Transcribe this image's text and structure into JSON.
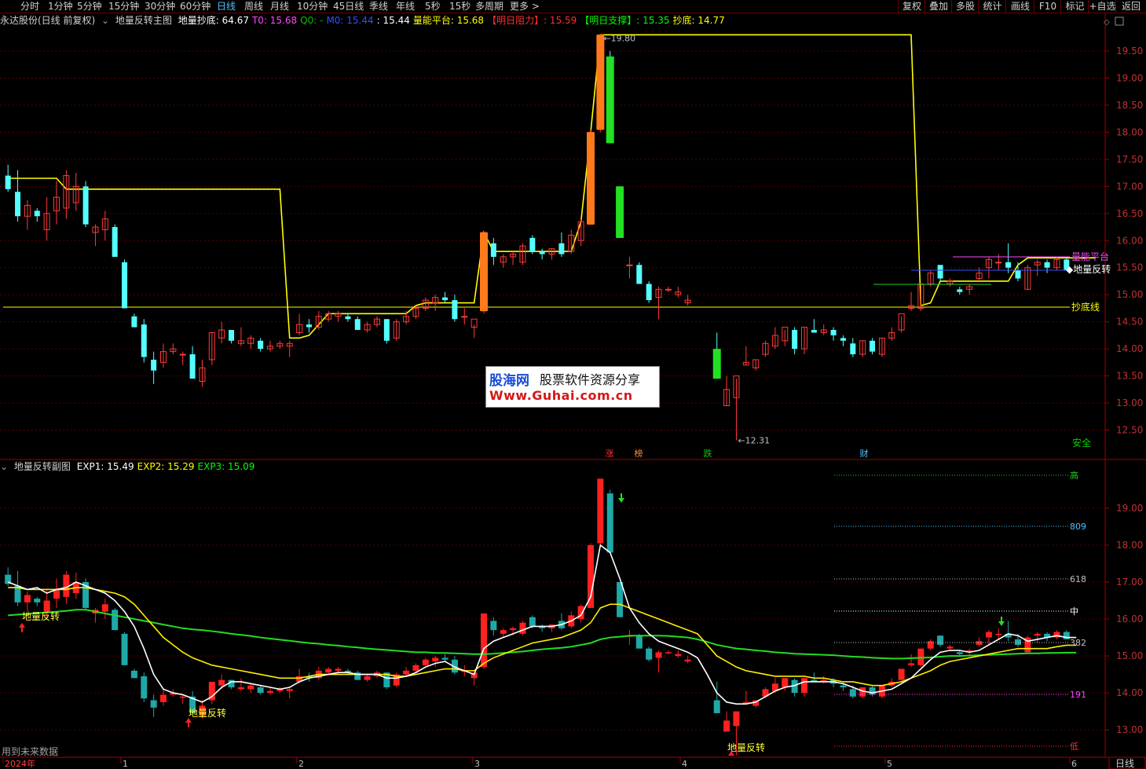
{
  "toolbar": {
    "periods": [
      "分时",
      "1分钟",
      "5分钟",
      "15分钟",
      "30分钟",
      "60分钟",
      "日线",
      "周线",
      "月线",
      "10分钟",
      "45日线",
      "季线",
      "年线",
      "5秒",
      "15秒",
      "多周期",
      "更多 >"
    ],
    "active": "日线",
    "right_buttons": [
      "复权",
      "叠加",
      "多股",
      "统计",
      "画线",
      "F10",
      "标记",
      "+自选",
      "返回"
    ]
  },
  "main_info": {
    "stock": "永达股份(日线 前复权)",
    "indicator": "地量反转主图",
    "items": [
      {
        "label": "地量抄底:",
        "value": "64.67",
        "color": "#ffffff"
      },
      {
        "label": "T0:",
        "value": "15.68",
        "color": "#ff44ff"
      },
      {
        "label": "Q0:",
        "value": "-",
        "color": "#00c000"
      },
      {
        "label": "M0:",
        "value": "15.44",
        "color": "#3050ff"
      },
      {
        "label": ":",
        "value": "15.44",
        "color": "#ffffff"
      },
      {
        "label": "量能平台:",
        "value": "15.68",
        "color": "#ffff00"
      },
      {
        "label": "【明日阻力】:",
        "value": "15.59",
        "color": "#ff3030"
      },
      {
        "label": "【明日支撑】:",
        "value": "15.35",
        "color": "#00ff00"
      },
      {
        "label": "抄底:",
        "value": "14.77",
        "color": "#ffff00"
      }
    ]
  },
  "sub_info": {
    "indicator": "地量反转副图",
    "items": [
      {
        "label": "EXP1:",
        "value": "15.49",
        "color": "#ffffff"
      },
      {
        "label": "EXP2:",
        "value": "15.29",
        "color": "#ffff00"
      },
      {
        "label": "EXP3:",
        "value": "15.09",
        "color": "#00ff00"
      }
    ]
  },
  "main_axis_ticks": [
    19.5,
    19.0,
    18.5,
    18.0,
    17.5,
    17.0,
    16.5,
    16.0,
    15.5,
    15.0,
    14.5,
    14.0,
    13.5,
    13.0,
    12.5
  ],
  "sub_axis_ticks": [
    19.0,
    18.0,
    17.0,
    16.0,
    15.0,
    14.0,
    13.0
  ],
  "annotations": {
    "high_label": "19.80",
    "low_label": "12.31",
    "volume_platform": "量能平台",
    "reversal_right": "◆地量反转",
    "bottom_line": "抄底线",
    "safe": "安全",
    "signals": [
      "涨",
      "榜",
      "跌",
      "财"
    ],
    "sub_reversal": "地量反转",
    "fib": [
      "高",
      "809",
      "618",
      "中",
      "382",
      "191",
      "低"
    ],
    "future_data_note": "用到未来数据"
  },
  "time_axis": [
    "2024年",
    "1",
    "2",
    "3",
    "4",
    "5",
    "6"
  ],
  "period_badge": "日线",
  "watermark": {
    "line1a": "股海网",
    "line1b": "股票软件资源分享",
    "line2": "Www.Guhai.com.cn"
  },
  "chart_data": {
    "type": "candlestick",
    "price_range": [
      12.0,
      19.95
    ],
    "candles": [
      {
        "o": 17.2,
        "h": 17.4,
        "l": 16.9,
        "c": 16.95
      },
      {
        "o": 16.9,
        "h": 17.3,
        "l": 16.35,
        "c": 16.45
      },
      {
        "o": 16.45,
        "h": 16.75,
        "l": 16.2,
        "c": 16.65
      },
      {
        "o": 16.55,
        "h": 16.6,
        "l": 16.35,
        "c": 16.45
      },
      {
        "o": 16.2,
        "h": 16.8,
        "l": 16.0,
        "c": 16.5
      },
      {
        "o": 16.55,
        "h": 17.1,
        "l": 16.3,
        "c": 16.8
      },
      {
        "o": 16.6,
        "h": 17.3,
        "l": 16.4,
        "c": 17.2
      },
      {
        "o": 16.7,
        "h": 17.25,
        "l": 16.55,
        "c": 17.0
      },
      {
        "o": 17.0,
        "h": 17.1,
        "l": 16.25,
        "c": 16.3
      },
      {
        "o": 16.15,
        "h": 16.3,
        "l": 15.9,
        "c": 16.25
      },
      {
        "o": 16.2,
        "h": 16.55,
        "l": 16.0,
        "c": 16.4
      },
      {
        "o": 16.25,
        "h": 16.3,
        "l": 15.7,
        "c": 15.7
      },
      {
        "o": 15.6,
        "h": 15.65,
        "l": 14.75,
        "c": 14.75
      },
      {
        "o": 14.6,
        "h": 14.65,
        "l": 14.4,
        "c": 14.4
      },
      {
        "o": 14.45,
        "h": 14.55,
        "l": 13.75,
        "c": 13.85
      },
      {
        "o": 13.8,
        "h": 13.95,
        "l": 13.35,
        "c": 13.6
      },
      {
        "o": 13.75,
        "h": 14.1,
        "l": 13.65,
        "c": 13.95
      },
      {
        "o": 13.95,
        "h": 14.1,
        "l": 13.9,
        "c": 14.0
      },
      {
        "o": 13.9,
        "h": 13.95,
        "l": 13.7,
        "c": 13.9
      },
      {
        "o": 13.9,
        "h": 14.05,
        "l": 13.6,
        "c": 13.45
      },
      {
        "o": 13.4,
        "h": 13.8,
        "l": 13.3,
        "c": 13.65
      },
      {
        "o": 13.8,
        "h": 14.3,
        "l": 13.7,
        "c": 14.3
      },
      {
        "o": 14.2,
        "h": 14.5,
        "l": 14.1,
        "c": 14.35
      },
      {
        "o": 14.35,
        "h": 14.35,
        "l": 14.1,
        "c": 14.15
      },
      {
        "o": 14.1,
        "h": 14.4,
        "l": 14.05,
        "c": 14.15
      },
      {
        "o": 14.1,
        "h": 14.25,
        "l": 14.0,
        "c": 14.2
      },
      {
        "o": 14.15,
        "h": 14.2,
        "l": 13.95,
        "c": 14.0
      },
      {
        "o": 14.0,
        "h": 14.15,
        "l": 13.95,
        "c": 14.05
      },
      {
        "o": 14.05,
        "h": 14.15,
        "l": 14.0,
        "c": 14.1
      },
      {
        "o": 14.05,
        "h": 14.15,
        "l": 13.85,
        "c": 14.1
      },
      {
        "o": 14.3,
        "h": 14.65,
        "l": 14.25,
        "c": 14.45
      },
      {
        "o": 14.45,
        "h": 14.55,
        "l": 14.3,
        "c": 14.4
      },
      {
        "o": 14.4,
        "h": 14.7,
        "l": 14.35,
        "c": 14.6
      },
      {
        "o": 14.55,
        "h": 14.7,
        "l": 14.5,
        "c": 14.65
      },
      {
        "o": 14.6,
        "h": 14.7,
        "l": 14.5,
        "c": 14.65
      },
      {
        "o": 14.6,
        "h": 14.65,
        "l": 14.5,
        "c": 14.55
      },
      {
        "o": 14.55,
        "h": 14.6,
        "l": 14.35,
        "c": 14.35
      },
      {
        "o": 14.35,
        "h": 14.5,
        "l": 14.3,
        "c": 14.45
      },
      {
        "o": 14.45,
        "h": 14.6,
        "l": 14.4,
        "c": 14.55
      },
      {
        "o": 14.55,
        "h": 14.55,
        "l": 14.1,
        "c": 14.15
      },
      {
        "o": 14.2,
        "h": 14.55,
        "l": 14.15,
        "c": 14.5
      },
      {
        "o": 14.5,
        "h": 14.7,
        "l": 14.45,
        "c": 14.6
      },
      {
        "o": 14.6,
        "h": 14.8,
        "l": 14.55,
        "c": 14.75
      },
      {
        "o": 14.75,
        "h": 14.95,
        "l": 14.7,
        "c": 14.9
      },
      {
        "o": 14.85,
        "h": 15.0,
        "l": 14.7,
        "c": 14.95
      },
      {
        "o": 14.95,
        "h": 15.05,
        "l": 14.85,
        "c": 14.9
      },
      {
        "o": 14.9,
        "h": 15.0,
        "l": 14.5,
        "c": 14.55
      },
      {
        "o": 14.6,
        "h": 14.75,
        "l": 14.45,
        "c": 14.6
      },
      {
        "o": 14.4,
        "h": 14.45,
        "l": 14.2,
        "c": 14.55
      },
      {
        "o": 14.7,
        "h": 16.15,
        "l": 14.65,
        "c": 16.15
      },
      {
        "o": 15.95,
        "h": 16.05,
        "l": 15.55,
        "c": 15.7
      },
      {
        "o": 15.6,
        "h": 15.75,
        "l": 15.5,
        "c": 15.7
      },
      {
        "o": 15.7,
        "h": 15.8,
        "l": 15.55,
        "c": 15.75
      },
      {
        "o": 15.6,
        "h": 15.95,
        "l": 15.55,
        "c": 15.9
      },
      {
        "o": 16.05,
        "h": 16.1,
        "l": 15.75,
        "c": 15.8
      },
      {
        "o": 15.8,
        "h": 15.85,
        "l": 15.65,
        "c": 15.75
      },
      {
        "o": 15.75,
        "h": 15.85,
        "l": 15.65,
        "c": 15.85
      },
      {
        "o": 15.95,
        "h": 16.15,
        "l": 15.7,
        "c": 15.75
      },
      {
        "o": 15.8,
        "h": 16.2,
        "l": 15.75,
        "c": 16.1
      },
      {
        "o": 16.0,
        "h": 16.4,
        "l": 15.9,
        "c": 16.35
      },
      {
        "o": 16.3,
        "h": 18.05,
        "l": 16.3,
        "c": 18.0
      },
      {
        "o": 18.05,
        "h": 19.8,
        "l": 18.0,
        "c": 19.8
      },
      {
        "o": 19.4,
        "h": 19.5,
        "l": 17.8,
        "c": 17.8
      },
      {
        "o": 17.0,
        "h": 17.0,
        "l": 16.05,
        "c": 16.05
      },
      {
        "o": 15.55,
        "h": 15.7,
        "l": 15.3,
        "c": 15.55
      },
      {
        "o": 15.55,
        "h": 15.6,
        "l": 15.2,
        "c": 15.2
      },
      {
        "o": 15.2,
        "h": 15.25,
        "l": 14.85,
        "c": 14.9
      },
      {
        "o": 14.95,
        "h": 15.15,
        "l": 14.55,
        "c": 15.1
      },
      {
        "o": 15.1,
        "h": 15.15,
        "l": 15.05,
        "c": 15.1
      },
      {
        "o": 15.0,
        "h": 15.15,
        "l": 14.95,
        "c": 15.05
      },
      {
        "o": 14.85,
        "h": 15.0,
        "l": 14.8,
        "c": 14.9
      },
      null,
      null,
      {
        "o": 13.8,
        "h": 14.3,
        "l": 13.45,
        "c": 13.45
      },
      {
        "o": 12.95,
        "h": 13.5,
        "l": 12.95,
        "c": 13.25
      },
      {
        "o": 13.1,
        "h": 13.45,
        "l": 12.31,
        "c": 13.5
      },
      {
        "o": 13.7,
        "h": 14.05,
        "l": 13.7,
        "c": 13.75
      },
      {
        "o": 13.65,
        "h": 13.8,
        "l": 13.6,
        "c": 13.8
      },
      {
        "o": 13.9,
        "h": 14.15,
        "l": 13.85,
        "c": 14.1
      },
      {
        "o": 14.05,
        "h": 14.4,
        "l": 14.0,
        "c": 14.25
      },
      {
        "o": 14.15,
        "h": 14.35,
        "l": 14.05,
        "c": 14.4
      },
      {
        "o": 14.35,
        "h": 14.4,
        "l": 13.9,
        "c": 14.0
      },
      {
        "o": 14.0,
        "h": 14.4,
        "l": 13.9,
        "c": 14.4
      },
      {
        "o": 14.35,
        "h": 14.55,
        "l": 14.3,
        "c": 14.3
      },
      {
        "o": 14.3,
        "h": 14.45,
        "l": 14.25,
        "c": 14.35
      },
      {
        "o": 14.35,
        "h": 14.4,
        "l": 14.15,
        "c": 14.25
      },
      {
        "o": 14.2,
        "h": 14.25,
        "l": 14.05,
        "c": 14.15
      },
      {
        "o": 14.1,
        "h": 14.2,
        "l": 13.85,
        "c": 13.9
      },
      {
        "o": 13.9,
        "h": 14.15,
        "l": 13.85,
        "c": 14.15
      },
      {
        "o": 14.15,
        "h": 14.2,
        "l": 13.9,
        "c": 13.95
      },
      {
        "o": 13.9,
        "h": 14.2,
        "l": 13.85,
        "c": 14.2
      },
      {
        "o": 14.2,
        "h": 14.4,
        "l": 14.15,
        "c": 14.3
      },
      {
        "o": 14.35,
        "h": 14.6,
        "l": 14.3,
        "c": 14.65
      },
      {
        "o": 14.75,
        "h": 15.05,
        "l": 14.7,
        "c": 14.8
      },
      {
        "o": 14.75,
        "h": 15.2,
        "l": 14.7,
        "c": 15.2
      },
      {
        "o": 15.2,
        "h": 15.45,
        "l": 15.15,
        "c": 15.4
      },
      {
        "o": 15.55,
        "h": 15.55,
        "l": 15.25,
        "c": 15.3
      },
      {
        "o": 15.2,
        "h": 15.3,
        "l": 15.15,
        "c": 15.25
      },
      {
        "o": 15.1,
        "h": 15.15,
        "l": 15.0,
        "c": 15.05
      },
      {
        "o": 15.1,
        "h": 15.2,
        "l": 15.0,
        "c": 15.15
      },
      {
        "o": 15.3,
        "h": 15.5,
        "l": 15.25,
        "c": 15.4
      },
      {
        "o": 15.5,
        "h": 15.7,
        "l": 15.3,
        "c": 15.65
      },
      {
        "o": 15.6,
        "h": 15.75,
        "l": 15.45,
        "c": 15.6
      },
      {
        "o": 15.6,
        "h": 15.95,
        "l": 15.4,
        "c": 15.5
      },
      {
        "o": 15.45,
        "h": 15.6,
        "l": 15.25,
        "c": 15.3
      },
      {
        "o": 15.1,
        "h": 15.55,
        "l": 15.1,
        "c": 15.5
      },
      {
        "o": 15.55,
        "h": 15.65,
        "l": 15.35,
        "c": 15.6
      },
      {
        "o": 15.6,
        "h": 15.65,
        "l": 15.4,
        "c": 15.5
      },
      {
        "o": 15.5,
        "h": 15.7,
        "l": 15.45,
        "c": 15.65
      },
      {
        "o": 15.65,
        "h": 15.7,
        "l": 15.45,
        "c": 15.45
      }
    ],
    "platform_line": [
      17.15,
      17.15,
      17.15,
      17.15,
      17.15,
      17.15,
      16.95,
      16.95,
      16.95,
      16.95,
      16.95,
      16.95,
      16.95,
      16.95,
      16.95,
      16.95,
      16.95,
      16.95,
      16.95,
      16.95,
      16.95,
      16.95,
      16.95,
      16.95,
      16.95,
      16.95,
      16.95,
      16.95,
      16.95,
      14.2,
      14.2,
      14.25,
      14.45,
      14.65,
      14.65,
      14.65,
      14.65,
      14.65,
      14.65,
      14.65,
      14.65,
      14.65,
      14.8,
      14.85,
      14.85,
      14.85,
      14.85,
      14.85,
      14.85,
      16.15,
      15.8,
      15.8,
      15.8,
      15.8,
      15.8,
      15.8,
      15.8,
      15.8,
      15.8,
      16.35,
      18.0,
      19.8,
      19.8,
      19.8,
      19.8,
      19.8,
      19.8,
      19.8,
      19.8,
      19.8,
      19.8,
      19.8,
      19.8,
      19.8,
      19.8,
      19.8,
      19.8,
      19.8,
      19.8,
      19.8,
      19.8,
      19.8,
      19.8,
      19.8,
      19.8,
      19.8,
      19.8,
      19.8,
      19.8,
      19.8,
      19.8,
      19.8,
      19.8,
      19.8,
      14.8,
      14.85,
      15.25,
      15.25,
      15.25,
      15.25,
      15.25,
      15.25,
      15.25,
      15.25,
      15.55,
      15.68,
      15.68,
      15.68,
      15.68,
      15.68,
      15.68,
      15.68,
      15.68
    ],
    "bottom_line": 14.77,
    "sub_chart": {
      "exp1_white": [
        17.0,
        16.9,
        16.8,
        16.85,
        16.7,
        16.8,
        16.85,
        17.0,
        16.9,
        16.8,
        16.7,
        16.5,
        16.2,
        15.8,
        15.2,
        14.5,
        14.1,
        14.0,
        13.95,
        13.85,
        13.75,
        13.9,
        14.15,
        14.3,
        14.3,
        14.25,
        14.2,
        14.15,
        14.1,
        14.15,
        14.3,
        14.4,
        14.45,
        14.5,
        14.55,
        14.55,
        14.5,
        14.5,
        14.5,
        14.4,
        14.4,
        14.45,
        14.55,
        14.7,
        14.8,
        14.85,
        14.7,
        14.6,
        14.5,
        15.2,
        15.4,
        15.5,
        15.6,
        15.7,
        15.8,
        15.8,
        15.8,
        15.85,
        15.95,
        16.1,
        16.6,
        18.0,
        17.8,
        17.1,
        16.3,
        15.9,
        15.6,
        15.4,
        15.3,
        15.2,
        15.1,
        14.95,
        14.5,
        14.0,
        13.75,
        13.7,
        13.7,
        13.75,
        13.9,
        14.05,
        14.15,
        14.2,
        14.3,
        14.3,
        14.3,
        14.3,
        14.25,
        14.15,
        14.05,
        14.0,
        14.05,
        14.1,
        14.25,
        14.4,
        14.65,
        14.9,
        15.1,
        15.15,
        15.15,
        15.1,
        15.15,
        15.3,
        15.45,
        15.6,
        15.55,
        15.4,
        15.45,
        15.5,
        15.55,
        15.5,
        15.5
      ],
      "exp2_yellow": [
        16.85,
        16.85,
        16.8,
        16.8,
        16.8,
        16.8,
        16.8,
        16.85,
        16.85,
        16.8,
        16.75,
        16.7,
        16.6,
        16.4,
        16.1,
        15.8,
        15.5,
        15.3,
        15.1,
        14.95,
        14.85,
        14.75,
        14.7,
        14.65,
        14.6,
        14.55,
        14.5,
        14.45,
        14.4,
        14.4,
        14.4,
        14.45,
        14.5,
        14.5,
        14.5,
        14.5,
        14.5,
        14.5,
        14.5,
        14.5,
        14.45,
        14.45,
        14.5,
        14.55,
        14.6,
        14.65,
        14.65,
        14.6,
        14.6,
        14.8,
        14.95,
        15.05,
        15.15,
        15.25,
        15.35,
        15.4,
        15.45,
        15.5,
        15.6,
        15.7,
        15.9,
        16.3,
        16.4,
        16.4,
        16.3,
        16.2,
        16.1,
        16.0,
        15.9,
        15.8,
        15.7,
        15.6,
        15.3,
        15.0,
        14.85,
        14.7,
        14.6,
        14.55,
        14.5,
        14.45,
        14.45,
        14.45,
        14.45,
        14.4,
        14.4,
        14.35,
        14.3,
        14.3,
        14.25,
        14.2,
        14.2,
        14.25,
        14.3,
        14.4,
        14.5,
        14.6,
        14.75,
        14.85,
        14.9,
        14.95,
        15.0,
        15.05,
        15.1,
        15.15,
        15.2,
        15.2,
        15.2,
        15.2,
        15.25,
        15.29,
        15.29
      ],
      "exp3_green": [
        16.1,
        16.12,
        16.14,
        16.16,
        16.18,
        16.2,
        16.22,
        16.25,
        16.25,
        16.2,
        16.15,
        16.1,
        16.05,
        16.0,
        15.95,
        15.9,
        15.85,
        15.8,
        15.75,
        15.72,
        15.7,
        15.67,
        15.64,
        15.6,
        15.57,
        15.54,
        15.5,
        15.47,
        15.44,
        15.41,
        15.38,
        15.35,
        15.33,
        15.3,
        15.28,
        15.25,
        15.23,
        15.2,
        15.18,
        15.16,
        15.14,
        15.12,
        15.1,
        15.1,
        15.08,
        15.08,
        15.07,
        15.06,
        15.05,
        15.05,
        15.06,
        15.08,
        15.1,
        15.12,
        15.15,
        15.18,
        15.2,
        15.22,
        15.25,
        15.3,
        15.35,
        15.45,
        15.5,
        15.52,
        15.55,
        15.55,
        15.55,
        15.55,
        15.54,
        15.52,
        15.5,
        15.45,
        15.38,
        15.3,
        15.25,
        15.2,
        15.18,
        15.15,
        15.13,
        15.1,
        15.08,
        15.06,
        15.05,
        15.04,
        15.03,
        15.02,
        15.0,
        14.98,
        14.97,
        14.95,
        14.94,
        14.93,
        14.93,
        14.94,
        14.95,
        14.96,
        14.98,
        15.0,
        15.0,
        15.01,
        15.02,
        15.03,
        15.04,
        15.05,
        15.06,
        15.07,
        15.07,
        15.08,
        15.08,
        15.09,
        15.09
      ]
    }
  }
}
